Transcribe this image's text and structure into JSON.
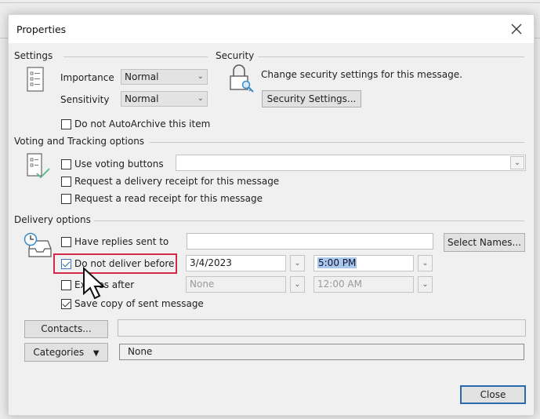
{
  "dialog": {
    "title": "Properties",
    "close_icon": "close-x-icon"
  },
  "settings": {
    "group_label": "Settings",
    "icon": "properties-list-icon",
    "importance_label": "Importance",
    "importance_value": "Normal",
    "sensitivity_label": "Sensitivity",
    "sensitivity_value": "Normal",
    "autoarchive_label": "Do not AutoArchive this item",
    "autoarchive_checked": false
  },
  "security": {
    "group_label": "Security",
    "icon": "lock-key-icon",
    "description": "Change security settings for this message.",
    "button_label": "Security Settings..."
  },
  "voting": {
    "group_label": "Voting and Tracking options",
    "icon": "checklist-icon",
    "use_voting_label": "Use voting buttons",
    "use_voting_checked": false,
    "voting_value": "",
    "delivery_receipt_label": "Request a delivery receipt for this message",
    "delivery_receipt_checked": false,
    "read_receipt_label": "Request a read receipt for this message",
    "read_receipt_checked": false
  },
  "delivery": {
    "group_label": "Delivery options",
    "icon": "clock-inbox-icon",
    "replies_label": "Have replies sent to",
    "replies_checked": false,
    "replies_value": "",
    "select_names_label": "Select Names...",
    "do_not_deliver_label": "Do not deliver before",
    "do_not_deliver_checked": true,
    "deliver_date": "3/4/2023",
    "deliver_time": "5:00 PM",
    "expires_label": "Expires after",
    "expires_checked": false,
    "expires_date": "None",
    "expires_time": "12:00 AM",
    "save_copy_label": "Save copy of sent message",
    "save_copy_checked": true
  },
  "bottom": {
    "contacts_label": "Contacts...",
    "contacts_value": "",
    "categories_label": "Categories",
    "categories_value": "None",
    "close_label": "Close"
  },
  "colors": {
    "highlight_border": "#d42a48",
    "selection_bg": "#a9c8ec",
    "default_button_border": "#2a6bb0"
  }
}
